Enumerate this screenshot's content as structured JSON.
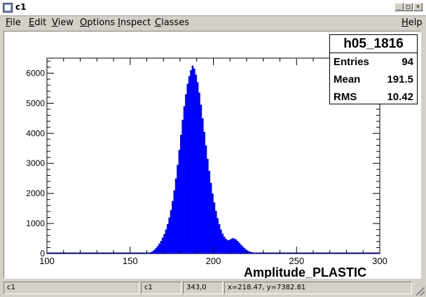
{
  "window": {
    "title": "c1",
    "icon": "root-canvas-icon",
    "controls": [
      "_",
      "□",
      "×"
    ]
  },
  "menu": {
    "items": [
      {
        "label": "File",
        "underline": "F",
        "rest": "ile"
      },
      {
        "label": "Edit",
        "underline": "E",
        "rest": "dit"
      },
      {
        "label": "View",
        "underline": "V",
        "rest": "iew"
      },
      {
        "label": "Options",
        "underline": "O",
        "rest": "ptions"
      },
      {
        "label": "Inspect",
        "underline": "I",
        "rest": "nspect"
      },
      {
        "label": "Classes",
        "underline": "C",
        "rest": "lasses"
      }
    ],
    "help": {
      "label": "Help",
      "underline": "H",
      "rest": "elp"
    }
  },
  "stats": {
    "title": "h05_1816",
    "entries_label": "Entries",
    "entries_value": "94",
    "mean_label": "Mean",
    "mean_value": "191.5",
    "rms_label": "RMS",
    "rms_value": "10.42"
  },
  "chart_data": {
    "type": "bar",
    "title": "h05_1816",
    "xlabel": "Amplitude_PLASTIC",
    "ylabel": "",
    "xlim": [
      100,
      300
    ],
    "ylim": [
      0,
      6500
    ],
    "bin_width": 1,
    "bin_start": 160,
    "fill_color": "#0000ff",
    "xticks": [
      100,
      150,
      200,
      250,
      300
    ],
    "yticks": [
      0,
      1000,
      2000,
      3000,
      4000,
      5000,
      6000
    ],
    "values": [
      20,
      30,
      50,
      80,
      120,
      180,
      250,
      330,
      420,
      530,
      650,
      800,
      980,
      1200,
      1450,
      1750,
      2100,
      2500,
      2950,
      3450,
      3950,
      4450,
      4900,
      5300,
      5650,
      5900,
      6100,
      6250,
      6150,
      5950,
      5700,
      5350,
      4950,
      4500,
      4050,
      3600,
      3150,
      2750,
      2350,
      2000,
      1700,
      1420,
      1180,
      980,
      800,
      660,
      560,
      490,
      450,
      450,
      480,
      510,
      500,
      470,
      420,
      360,
      300,
      240,
      190,
      140,
      100,
      75,
      55,
      40,
      28,
      20,
      15,
      10,
      8,
      5
    ]
  },
  "status": {
    "cells": [
      "c1",
      "c1",
      "343,0",
      "x=218.47, y=7382.81"
    ]
  },
  "colors": {
    "chrome": "#d4d0c8",
    "histogram": "#0000ff"
  }
}
